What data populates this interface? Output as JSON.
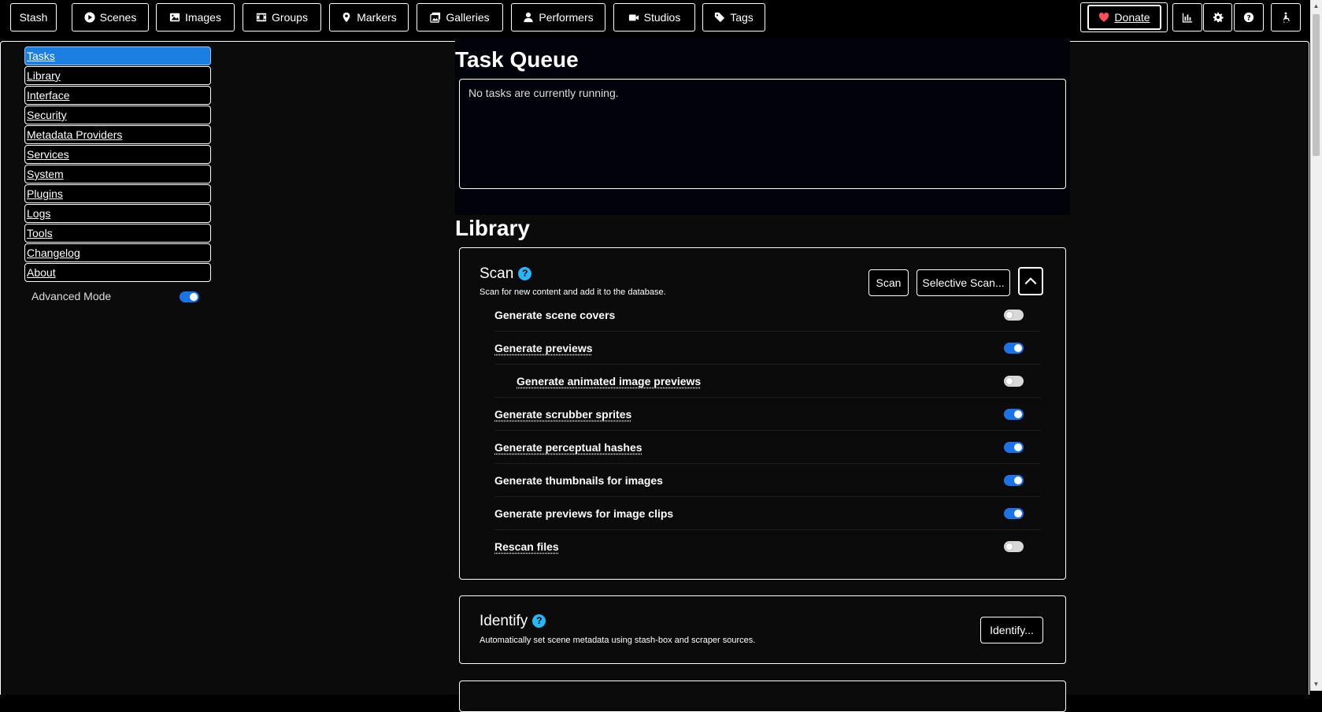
{
  "nav": {
    "brand": "Stash",
    "items": [
      {
        "label": "Scenes",
        "icon": "play-circle-icon"
      },
      {
        "label": "Images",
        "icon": "image-icon"
      },
      {
        "label": "Groups",
        "icon": "film-icon"
      },
      {
        "label": "Markers",
        "icon": "map-marker-icon"
      },
      {
        "label": "Galleries",
        "icon": "images-icon"
      },
      {
        "label": "Performers",
        "icon": "user-icon"
      },
      {
        "label": "Studios",
        "icon": "video-icon"
      },
      {
        "label": "Tags",
        "icon": "tag-icon"
      }
    ],
    "donate_label": "Donate",
    "right_icons": [
      "stats-icon",
      "gear-icon",
      "help-icon",
      "accessibility-icon"
    ]
  },
  "sidebar": {
    "items": [
      "Tasks",
      "Library",
      "Interface",
      "Security",
      "Metadata Providers",
      "Services",
      "System",
      "Plugins",
      "Logs",
      "Tools",
      "Changelog",
      "About"
    ],
    "active": "Tasks",
    "advanced_mode_label": "Advanced Mode",
    "advanced_mode_on": true
  },
  "task_queue": {
    "title": "Task Queue",
    "empty_text": "No tasks are currently running."
  },
  "library": {
    "title": "Library",
    "scan": {
      "title": "Scan",
      "description": "Scan for new content and add it to the database.",
      "scan_button": "Scan",
      "selective_button": "Selective Scan...",
      "options": [
        {
          "label": "Generate scene covers",
          "on": false,
          "indent": false,
          "dotted": false
        },
        {
          "label": "Generate previews",
          "on": true,
          "indent": false,
          "dotted": true
        },
        {
          "label": "Generate animated image previews",
          "on": false,
          "indent": true,
          "dotted": true
        },
        {
          "label": "Generate scrubber sprites",
          "on": true,
          "indent": false,
          "dotted": true
        },
        {
          "label": "Generate perceptual hashes",
          "on": true,
          "indent": false,
          "dotted": true
        },
        {
          "label": "Generate thumbnails for images",
          "on": true,
          "indent": false,
          "dotted": false
        },
        {
          "label": "Generate previews for image clips",
          "on": true,
          "indent": false,
          "dotted": false
        },
        {
          "label": "Rescan files",
          "on": false,
          "indent": false,
          "dotted": true
        }
      ]
    },
    "identify": {
      "title": "Identify",
      "description": "Automatically set scene metadata using stash-box and scraper sources.",
      "button": "Identify..."
    }
  },
  "colors": {
    "accent": "#1a7fe0",
    "toggle_on": "#1a73e8",
    "help_icon": "#29b6f6",
    "donate_heart": "#ff4d5a"
  }
}
